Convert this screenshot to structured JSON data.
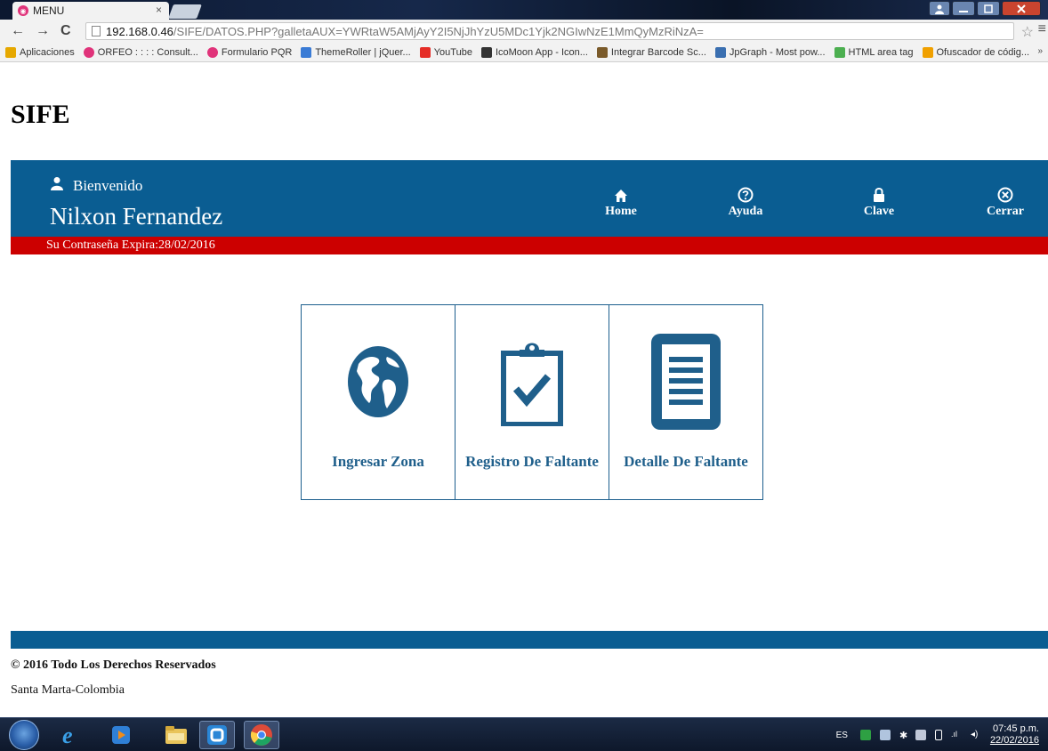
{
  "browser": {
    "tab_title": "MENU",
    "tab_close": "×",
    "url_host": "192.168.0.46",
    "url_path": "/SIFE/DATOS.PHP?galletaAUX=YWRtaW5AMjAyY2I5NjJhYzU5MDc1Yjk2NGIwNzE1MmQyMzRiNzA=",
    "bookmarks": [
      {
        "label": "Aplicaciones",
        "color": "#e6a800"
      },
      {
        "label": "ORFEO : : : : Consult...",
        "color": "#e0337a"
      },
      {
        "label": "Formulario PQR",
        "color": "#e0337a"
      },
      {
        "label": "ThemeRoller | jQuer...",
        "color": "#3a7bd5"
      },
      {
        "label": "YouTube",
        "color": "#e52d27"
      },
      {
        "label": "IcoMoon App - Icon...",
        "color": "#333333"
      },
      {
        "label": "Integrar Barcode Sc...",
        "color": "#7a5a2a"
      },
      {
        "label": "JpGraph - Most pow...",
        "color": "#3a6fb0"
      },
      {
        "label": "HTML area tag",
        "color": "#4caf50"
      },
      {
        "label": "Ofuscador de códig...",
        "color": "#f0a000"
      }
    ],
    "bookmarks_more": "»"
  },
  "page": {
    "site_title": "SIFE",
    "welcome": "Bienvenido",
    "user_name": "Nilxon Fernandez",
    "nav": {
      "home": "Home",
      "ayuda": "Ayuda",
      "clave": "Clave",
      "cerrar": "Cerrar"
    },
    "expiry": "Su Contraseña Expira:28/02/2016",
    "tiles": [
      {
        "label": "Ingresar Zona",
        "icon": "globe-icon"
      },
      {
        "label": "Registro De Faltante",
        "icon": "clipboard-check-icon"
      },
      {
        "label": "Detalle De Faltante",
        "icon": "document-icon"
      }
    ],
    "copyright": "© 2016 Todo Los Derechos Reservados",
    "location": "Santa Marta-Colombia"
  },
  "taskbar": {
    "lang": "ES",
    "time": "07:45 p.m.",
    "date": "22/02/2016"
  },
  "colors": {
    "brand_blue": "#0a5d92",
    "alert_red": "#cc0000",
    "tile_text": "#1f5f8b"
  }
}
